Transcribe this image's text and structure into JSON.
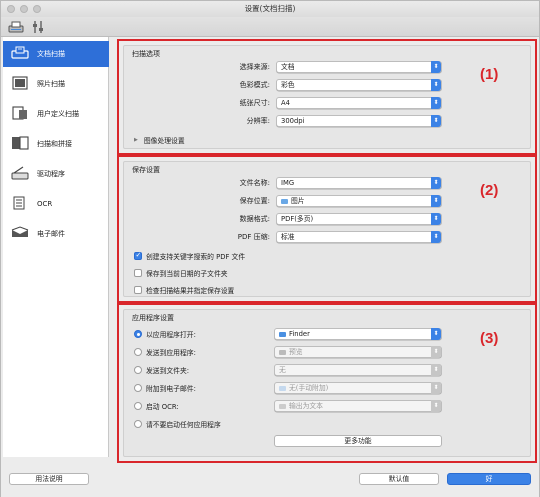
{
  "window": {
    "title": "设置(文档扫描)"
  },
  "toolbar": {
    "icons": [
      "scan-settings-icon",
      "general-settings-icon"
    ]
  },
  "sidebar": {
    "items": [
      {
        "label": "文档扫描",
        "icon": "document-scan-icon",
        "active": true
      },
      {
        "label": "照片扫描",
        "icon": "photo-scan-icon"
      },
      {
        "label": "用户定义扫描",
        "icon": "custom-scan-icon"
      },
      {
        "label": "扫描和拼接",
        "icon": "stitch-scan-icon"
      },
      {
        "label": "驱动程序",
        "icon": "driver-icon"
      },
      {
        "label": "OCR",
        "icon": "ocr-icon"
      },
      {
        "label": "电子邮件",
        "icon": "email-icon"
      }
    ]
  },
  "scan_options": {
    "title": "扫描选项",
    "marker": "(1)",
    "rows": [
      {
        "label": "选择来源:",
        "value": "文档"
      },
      {
        "label": "色彩模式:",
        "value": "彩色"
      },
      {
        "label": "纸张尺寸:",
        "value": "A4"
      },
      {
        "label": "分辨率:",
        "value": "300dpi"
      }
    ],
    "disclosure": "图像处理设置"
  },
  "save_settings": {
    "title": "保存设置",
    "marker": "(2)",
    "rows": [
      {
        "label": "文件名称:",
        "value": "IMG"
      },
      {
        "label": "保存位置:",
        "value": "图片"
      },
      {
        "label": "数据格式:",
        "value": "PDF(多页)"
      },
      {
        "label": "PDF 压缩:",
        "value": "标准"
      }
    ],
    "checkboxes": [
      {
        "label": "创建支持关键字搜索的 PDF 文件",
        "checked": true
      },
      {
        "label": "保存到当前日期的子文件夹",
        "checked": false
      },
      {
        "label": "检查扫描结果并指定保存设置",
        "checked": false
      }
    ]
  },
  "app_settings": {
    "title": "应用程序设置",
    "marker": "(3)",
    "rows": [
      {
        "label": "以应用程序打开:",
        "value": "Finder",
        "checked": true,
        "disabled": false
      },
      {
        "label": "发送到应用程序:",
        "value": "预览",
        "checked": false,
        "disabled": true
      },
      {
        "label": "发送到文件夹:",
        "value": "无",
        "checked": false,
        "disabled": true
      },
      {
        "label": "附加到电子邮件:",
        "value": "无(手动附加)",
        "checked": false,
        "disabled": true
      },
      {
        "label": "启动 OCR:",
        "value": "输出为文本",
        "checked": false,
        "disabled": true
      },
      {
        "label": "请不要启动任何应用程序",
        "value": "",
        "checked": false,
        "disabled": true
      }
    ],
    "more_button": "更多功能"
  },
  "footer": {
    "help_button": "用法说明",
    "defaults_button": "默认值",
    "ok_button": "好"
  }
}
